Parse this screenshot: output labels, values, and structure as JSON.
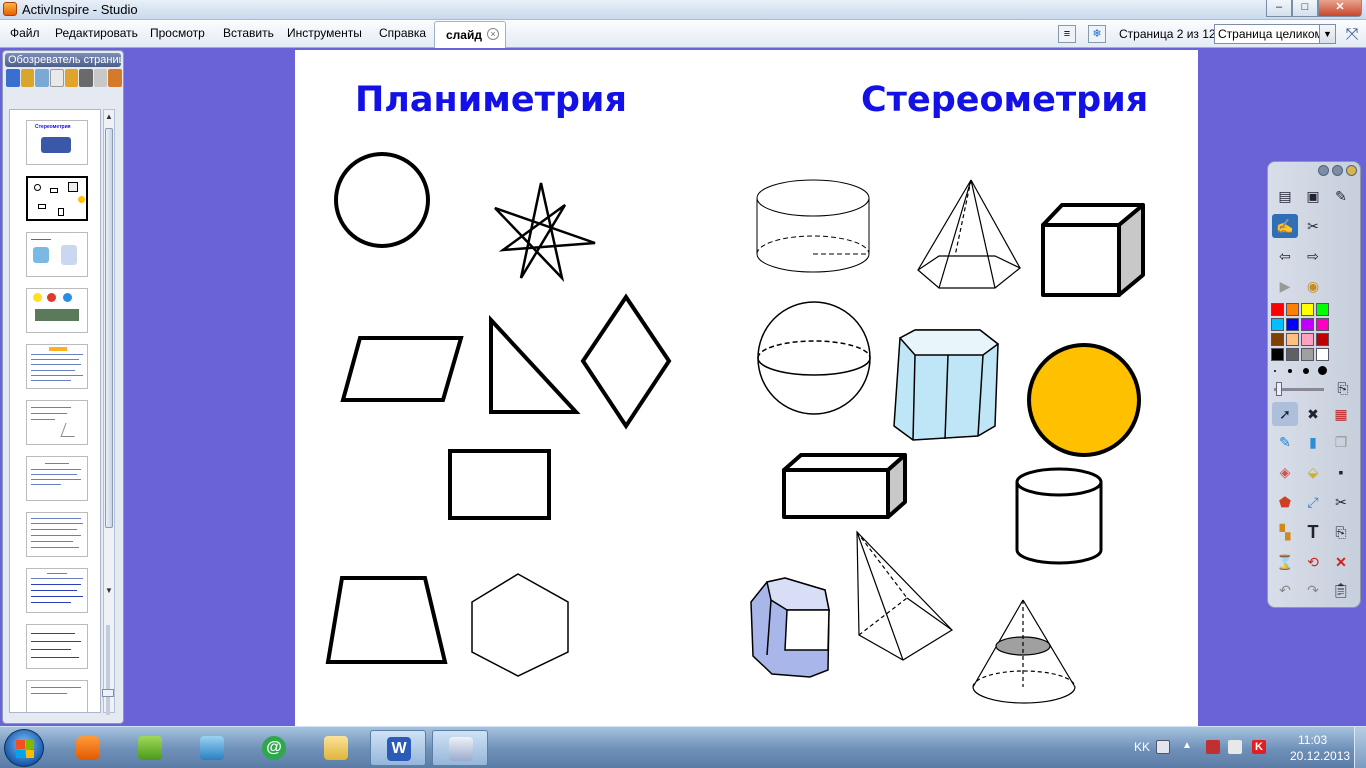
{
  "window": {
    "title": "ActivInspire - Studio",
    "controls": [
      "–",
      "□",
      "✕"
    ]
  },
  "menu": {
    "items": [
      "Файл",
      "Редактировать",
      "Просмотр",
      "Вставить",
      "Инструменты",
      "Справка"
    ],
    "tab_label": "слайд",
    "page_info": "Страница 2 из 12",
    "zoom_select": "Страница целиком"
  },
  "browser": {
    "title": "Обозреватель страниц",
    "thumbnail_count": 11,
    "selected_index": 1,
    "first_thumb_title": "Стереометрия"
  },
  "slide": {
    "left_heading": "Планиметрия",
    "right_heading": "Стереометрия",
    "heading_color": "#1411e6",
    "left_shapes": [
      "circle",
      "star",
      "parallelogram",
      "right-triangle",
      "rhombus",
      "rectangle",
      "trapezoid",
      "hexagon"
    ],
    "right_shapes": [
      "cylinder",
      "pyramid",
      "cube",
      "sphere",
      "hexagonal-prism",
      "orange-circle",
      "rectangular-box",
      "cylinder",
      "hexagonal-prism",
      "tetrahedron",
      "cone"
    ],
    "accent_fill": "#ffc000",
    "prism_fill": "#bfe6f6",
    "hexprism_fill": "#a9b6ea"
  },
  "toolbox": {
    "colors": [
      "#ff0000",
      "#ff8000",
      "#ffff00",
      "#00ff00",
      "#00c0ff",
      "#0000ff",
      "#c000ff",
      "#ff00c0",
      "#804000",
      "#ffc080",
      "#ffa0c0",
      "#c00000",
      "#000000",
      "#606060",
      "#a0a0a0",
      "#ffffff"
    ]
  },
  "taskbar": {
    "language": "KK",
    "time": "11:03",
    "date": "20.12.2013"
  }
}
